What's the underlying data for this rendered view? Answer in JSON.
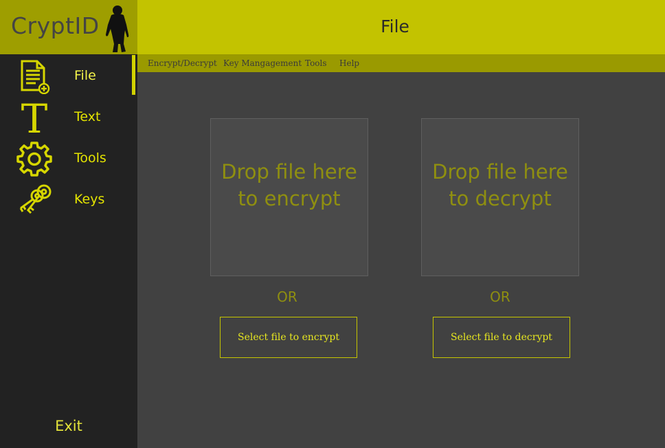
{
  "app": {
    "title": "CryptID",
    "logo_icon": "yeti-icon"
  },
  "header": {
    "title": "File"
  },
  "menu": {
    "items": [
      "Encrypt/Decrypt",
      "Key Mangagement",
      "Tools",
      "Help"
    ]
  },
  "sidebar": {
    "items": [
      {
        "label": "File",
        "icon": "file-add-icon",
        "active": true
      },
      {
        "label": "Text",
        "icon": "text-t-icon",
        "active": false
      },
      {
        "label": "Tools",
        "icon": "gear-icon",
        "active": false
      },
      {
        "label": "Keys",
        "icon": "keys-icon",
        "active": false
      }
    ],
    "exit_label": "Exit"
  },
  "encrypt": {
    "drop_text": "Drop file here to encrypt",
    "or_label": "OR",
    "button_label": "Select file to encrypt"
  },
  "decrypt": {
    "drop_text": "Drop file here to decrypt",
    "or_label": "OR",
    "button_label": "Select file to decrypt"
  },
  "colors": {
    "accent": "#c3c300",
    "sidebar_bg": "#222222",
    "content_bg": "#414141",
    "label_yellow": "#e3e300"
  }
}
